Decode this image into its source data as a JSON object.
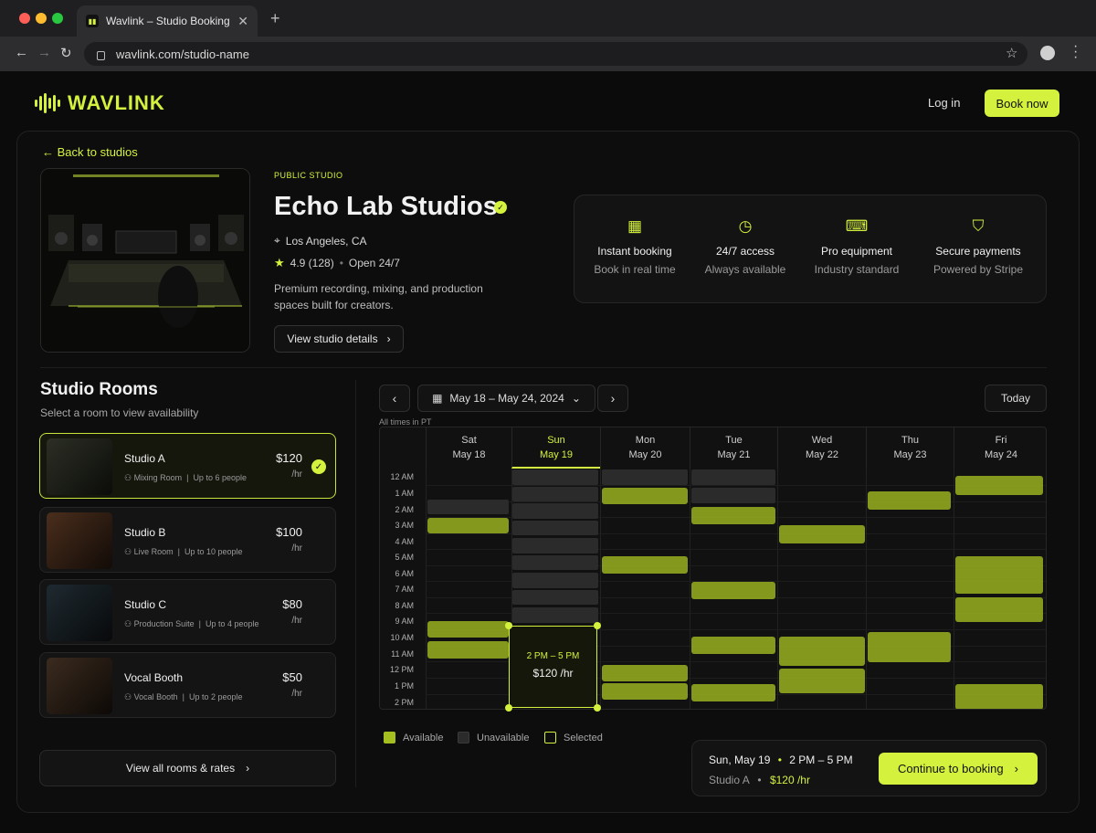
{
  "browser": {
    "tab_title": "Wavlink – Studio Booking",
    "url": "wavlink.com/studio-name"
  },
  "header": {
    "logo_text": "WAVLINK",
    "login_label": "Log in",
    "book_now_label": "Book now"
  },
  "studio": {
    "back_label": "Back to studios",
    "badge": "PUBLIC STUDIO",
    "name": "Echo Lab Studios",
    "location": "Los Angeles, CA",
    "rating": "4.9 (128)",
    "hours": "Open 24/7",
    "description": "Premium recording, mixing, and production spaces built for creators.",
    "view_details_label": "View studio details"
  },
  "features": [
    {
      "icon": "calendar-icon",
      "title": "Instant booking",
      "desc": "Book in real time"
    },
    {
      "icon": "clock-icon",
      "title": "24/7 access",
      "desc": "Always available"
    },
    {
      "icon": "equipment-icon",
      "title": "Pro equipment",
      "desc": "Industry standard"
    },
    {
      "icon": "shield-icon",
      "title": "Secure payments",
      "desc": "Powered by Stripe"
    }
  ],
  "rooms": {
    "title": "Studio Rooms",
    "subtitle": "Select a room to view availability",
    "items": [
      {
        "name": "Studio A",
        "type": "Mixing Room",
        "capacity": "Up to 6 people",
        "price": "$120",
        "unit": "/hr",
        "selected": true
      },
      {
        "name": "Studio B",
        "type": "Live Room",
        "capacity": "Up to 10 people",
        "price": "$100",
        "unit": "/hr",
        "selected": false
      },
      {
        "name": "Studio C",
        "type": "Production Suite",
        "capacity": "Up to 4 people",
        "price": "$80",
        "unit": "/hr",
        "selected": false
      },
      {
        "name": "Vocal Booth",
        "type": "Vocal Booth",
        "capacity": "Up to 2 people",
        "price": "$50",
        "unit": "/hr",
        "selected": false
      }
    ],
    "view_all_label": "View all rooms & rates"
  },
  "calendar": {
    "range_label": "May 18 – May 24, 2024",
    "today_label": "Today",
    "timezone_note": "All times in PT",
    "days": [
      {
        "name": "Sat",
        "date": "May 18"
      },
      {
        "name": "Sun",
        "date": "May 19"
      },
      {
        "name": "Mon",
        "date": "May 20"
      },
      {
        "name": "Tue",
        "date": "May 21"
      },
      {
        "name": "Wed",
        "date": "May 22"
      },
      {
        "name": "Thu",
        "date": "May 23"
      },
      {
        "name": "Fri",
        "date": "May 24"
      }
    ],
    "hours": [
      "12 AM",
      "1 AM",
      "2 AM",
      "3 AM",
      "4 AM",
      "5 AM",
      "6 AM",
      "7 AM",
      "8 AM",
      "9 AM",
      "10 AM",
      "11 AM",
      "12 PM",
      "1 PM",
      "2 PM"
    ],
    "selection": {
      "time": "2 PM – 5 PM",
      "price": "$120 /hr"
    }
  },
  "legend": {
    "available": "Available",
    "unavailable": "Unavailable",
    "selected": "Selected"
  },
  "summary": {
    "day": "Sun, May 19",
    "time": "2 PM – 5 PM",
    "room": "Studio A",
    "price": "$120 /hr",
    "continue_label": "Continue to booking"
  },
  "colors": {
    "accent": "#d4f23d",
    "available": "#a4bf1f",
    "unavailable": "#2b2b2c",
    "background": "#0b0b0c"
  }
}
